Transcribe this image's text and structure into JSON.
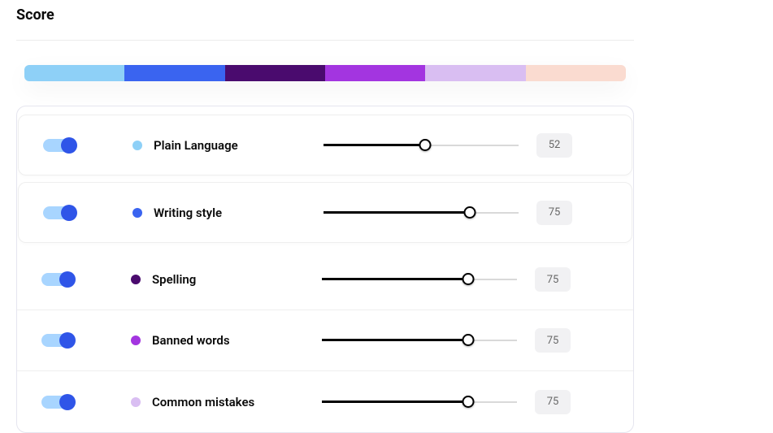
{
  "title": "Score",
  "colorBar": [
    "#8ed0f7",
    "#3a64f0",
    "#4a0b6e",
    "#a335e0",
    "#d9bef2",
    "#fadbd0"
  ],
  "metrics": [
    {
      "label": "Plain Language",
      "dot": "#8ed0f7",
      "value": 52,
      "toggled": true,
      "boxed": true
    },
    {
      "label": "Writing style",
      "dot": "#3a64f0",
      "value": 75,
      "toggled": true,
      "boxed": true
    },
    {
      "label": "Spelling",
      "dot": "#4a0b6e",
      "value": 75,
      "toggled": true,
      "boxed": false
    },
    {
      "label": "Banned words",
      "dot": "#a335e0",
      "value": 75,
      "toggled": true,
      "boxed": false
    },
    {
      "label": "Common mistakes",
      "dot": "#d9bef2",
      "value": 75,
      "toggled": true,
      "boxed": false
    }
  ]
}
